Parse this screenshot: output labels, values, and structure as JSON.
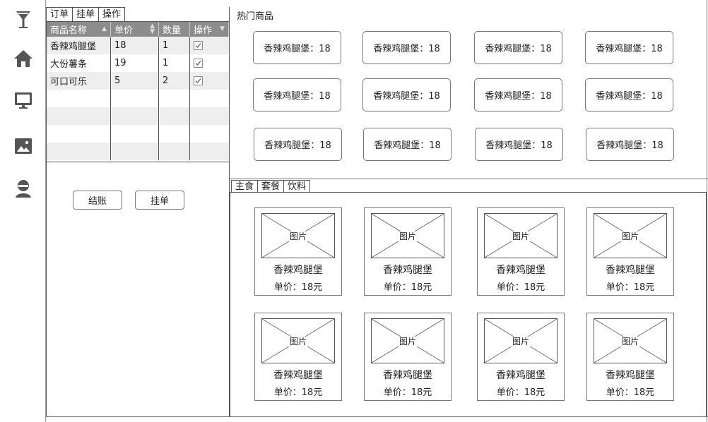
{
  "rail": {
    "items": [
      {
        "icon": "cocktail-icon"
      },
      {
        "icon": "home-icon"
      },
      {
        "icon": "monitor-icon"
      },
      {
        "icon": "image-icon"
      },
      {
        "icon": "user-icon"
      }
    ]
  },
  "order_tabs": [
    "订单",
    "挂单",
    "操作"
  ],
  "order_table": {
    "headers": [
      "商品名称",
      "单价",
      "数量",
      "操作"
    ],
    "rows": [
      {
        "name": "香辣鸡腿堡",
        "price": "18",
        "qty": "1",
        "checked": true
      },
      {
        "name": "大份薯条",
        "price": "19",
        "qty": "1",
        "checked": true
      },
      {
        "name": "可口可乐",
        "price": "5",
        "qty": "2",
        "checked": true
      }
    ]
  },
  "actions": {
    "checkout": "结账",
    "hold": "挂单"
  },
  "hot": {
    "title": "热门商品",
    "items": [
      "香辣鸡腿堡：18",
      "香辣鸡腿堡：18",
      "香辣鸡腿堡：18",
      "香辣鸡腿堡：18",
      "香辣鸡腿堡：18",
      "香辣鸡腿堡：18",
      "香辣鸡腿堡：18",
      "香辣鸡腿堡：18",
      "香辣鸡腿堡：18",
      "香辣鸡腿堡：18",
      "香辣鸡腿堡：18",
      "香辣鸡腿堡：18"
    ]
  },
  "category_tabs": [
    "主食",
    "套餐",
    "饮料"
  ],
  "catalog": {
    "placeholder": "图片",
    "items": [
      {
        "name": "香辣鸡腿堡",
        "price": "单价：18元"
      },
      {
        "name": "香辣鸡腿堡",
        "price": "单价：18元"
      },
      {
        "name": "香辣鸡腿堡",
        "price": "单价：18元"
      },
      {
        "name": "香辣鸡腿堡",
        "price": "单价：18元"
      },
      {
        "name": "香辣鸡腿堡",
        "price": "单价：18元"
      },
      {
        "name": "香辣鸡腿堡",
        "price": "单价：18元"
      },
      {
        "name": "香辣鸡腿堡",
        "price": "单价：18元"
      },
      {
        "name": "香辣鸡腿堡",
        "price": "单价：18元"
      }
    ]
  },
  "colors": {
    "header_bg": "#8c8c8c",
    "row_alt": "#eeeeee",
    "border": "#555555",
    "icon": "#555555"
  }
}
